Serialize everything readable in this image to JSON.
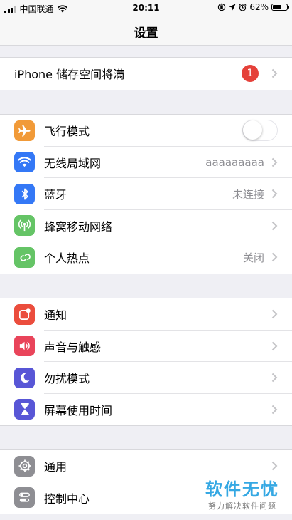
{
  "status_bar": {
    "carrier": "中国联通",
    "time": "20:11",
    "battery_percent": "62%",
    "battery_level": 0.62
  },
  "nav": {
    "title": "设置"
  },
  "storage": {
    "label": "iPhone 储存空间将满",
    "badge": "1"
  },
  "network": [
    {
      "label": "飞行模式",
      "value": "",
      "icon": "airplane-icon",
      "color": "#f19a38",
      "toggle": true,
      "toggle_on": false
    },
    {
      "label": "无线局域网",
      "value": "aaaaaaaaa",
      "icon": "wifi-icon",
      "color": "#3478f6"
    },
    {
      "label": "蓝牙",
      "value": "未连接",
      "icon": "bluetooth-icon",
      "color": "#3478f6"
    },
    {
      "label": "蜂窝移动网络",
      "value": "",
      "icon": "cellular-icon",
      "color": "#65c466"
    },
    {
      "label": "个人热点",
      "value": "关闭",
      "icon": "hotspot-icon",
      "color": "#65c466"
    }
  ],
  "notifications": [
    {
      "label": "通知",
      "icon": "notifications-icon",
      "color": "#eb4d3d"
    },
    {
      "label": "声音与触感",
      "icon": "sound-icon",
      "color": "#e9445a"
    },
    {
      "label": "勿扰模式",
      "icon": "moon-icon",
      "color": "#5856d6"
    },
    {
      "label": "屏幕使用时间",
      "icon": "hourglass-icon",
      "color": "#5856d6"
    }
  ],
  "general": [
    {
      "label": "通用",
      "icon": "gear-icon",
      "color": "#8e8e93"
    },
    {
      "label": "控制中心",
      "icon": "control-center-icon",
      "color": "#8e8e93"
    }
  ],
  "watermark": {
    "title": "软件无忧",
    "subtitle": "努力解决软件问题"
  }
}
